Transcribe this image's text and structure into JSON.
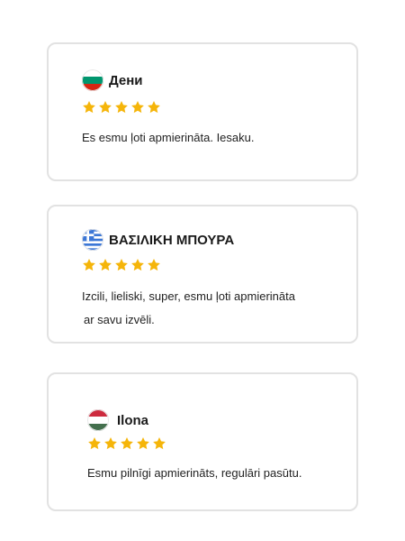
{
  "reviews": [
    {
      "name": "Дени",
      "flag": "bulgaria-flag-icon",
      "rating": 5,
      "text": "Es esmu ļoti apmierināta. Iesaku."
    },
    {
      "name": "ΒΑΣΙΛΙΚΗ ΜΠΟΥΡΑ",
      "flag": "greece-flag-icon",
      "rating": 5,
      "text_line1": "Izcili, lieliski, super, esmu ļoti apmierināta",
      "text_line2": "ar savu izvēli."
    },
    {
      "name": "Ilona",
      "flag": "hungary-flag-icon",
      "rating": 5,
      "text": "Esmu pilnīgi apmierināts, regulāri pasūtu."
    }
  ],
  "colors": {
    "star": "#f5b50a",
    "card_border": "#e2e2e2"
  }
}
